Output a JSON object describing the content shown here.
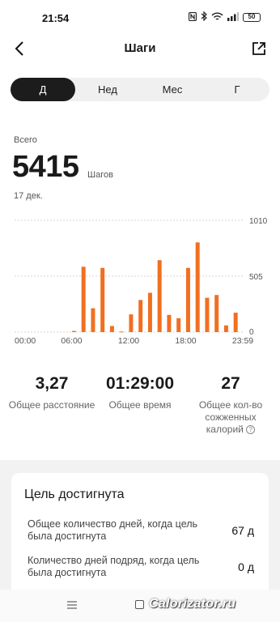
{
  "status_bar": {
    "time": "21:54",
    "icons": [
      "nfc-icon",
      "bluetooth-icon",
      "wifi-icon",
      "signal-icon"
    ],
    "battery": "50"
  },
  "header": {
    "title": "Шаги"
  },
  "tabs": [
    {
      "label": "Д",
      "active": true
    },
    {
      "label": "Нед",
      "active": false
    },
    {
      "label": "Мес",
      "active": false
    },
    {
      "label": "Г",
      "active": false
    }
  ],
  "summary": {
    "total_label": "Всего",
    "total_value": "5415",
    "unit": "Шагов",
    "date": "17 дек."
  },
  "chart_data": {
    "type": "bar",
    "bar_color": "#f07020",
    "x": [
      "00:00",
      "00:30",
      "01:00",
      "01:30",
      "02:00",
      "02:30",
      "03:00",
      "03:30",
      "04:00",
      "04:30",
      "05:00",
      "05:30",
      "06:00",
      "06:30",
      "07:00",
      "07:30",
      "08:00",
      "08:30",
      "09:00",
      "09:30",
      "10:00",
      "10:30",
      "11:00",
      "11:30",
      "12:00",
      "12:30",
      "13:00",
      "13:30",
      "14:00",
      "14:30",
      "15:00",
      "15:30",
      "16:00",
      "16:30",
      "17:00",
      "17:30",
      "18:00",
      "18:30",
      "19:00",
      "19:30",
      "20:00",
      "20:30",
      "21:00",
      "21:30",
      "22:00",
      "22:30",
      "23:00",
      "23:30"
    ],
    "values": [
      0,
      0,
      0,
      0,
      0,
      0,
      0,
      0,
      0,
      0,
      0,
      0,
      10,
      0,
      590,
      0,
      215,
      0,
      580,
      0,
      55,
      0,
      5,
      0,
      160,
      0,
      290,
      0,
      355,
      0,
      650,
      0,
      155,
      0,
      125,
      0,
      580,
      0,
      810,
      0,
      310,
      0,
      335,
      0,
      60,
      0,
      175,
      0
    ],
    "xtick_labels": [
      "00:00",
      "06:00",
      "12:00",
      "18:00",
      "23:59"
    ],
    "ytick_labels": [
      "1010",
      "505",
      "0"
    ],
    "ylim": [
      0,
      1010
    ]
  },
  "stats": [
    {
      "value": "3,27",
      "label": "Общее расстояние"
    },
    {
      "value": "01:29:00",
      "label": "Общее время"
    },
    {
      "value": "27",
      "label": "Общее кол-во сожженных калорий"
    }
  ],
  "goal": {
    "title": "Цель достигнута",
    "rows": [
      {
        "label": "Общее количество дней, когда цель была достигнута",
        "value": "67 д"
      },
      {
        "label": "Количество дней подряд, когда цель была достигнута",
        "value": "0 д"
      }
    ]
  },
  "watermark": "Calorizator.ru"
}
